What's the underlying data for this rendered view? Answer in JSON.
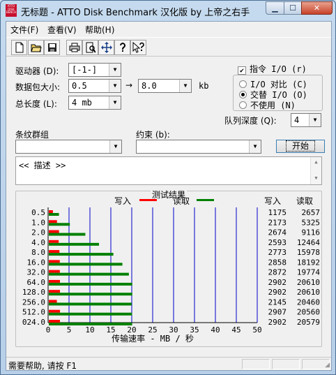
{
  "window": {
    "title": "无标题 - ATTO Disk Benchmark 汉化版 by 上帝之右手",
    "icon_text": "ATTO DISK BENCH"
  },
  "menu": [
    "文件(F)",
    "查看(V)",
    "帮助(H)"
  ],
  "toolbar": [
    "new-icon",
    "open-icon",
    "save-icon",
    "print-icon",
    "print-preview-icon",
    "move-icon",
    "help-icon",
    "context-help-icon"
  ],
  "form": {
    "drive_label": "驱动器 (D):",
    "drive_value": "[-1-]",
    "transfer_label": "数据包大小:",
    "transfer_from": "0.5",
    "transfer_to": "8.0",
    "transfer_unit": "kb",
    "total_label": "总长度 (L):",
    "total_value": "4 mb",
    "stripe_label": "条纹群组",
    "stripe_value": "",
    "constraint_label": "约束 (b):",
    "constraint_value": "",
    "start_label": "开始",
    "direct_io_label": "指令 I/O (r)",
    "direct_io_checked": true,
    "io_options": [
      "I/O 对比 (C)",
      "交替 I/O (O)",
      "不使用 (N)"
    ],
    "io_selected": 1,
    "queue_label": "队列深度 (Q):",
    "queue_value": "4"
  },
  "description": "<< 描述 >>",
  "results": {
    "title": "测试结果",
    "write_label": "写入",
    "read_label": "读取",
    "write_col_header": "写入",
    "read_col_header": "读取",
    "x_axis_label": "传输速率 - MB / 秒",
    "colors": {
      "write": "#ff0000",
      "read": "#008000",
      "grid": "#0000cc"
    }
  },
  "chart_data": {
    "type": "bar",
    "categories": [
      "0.5",
      "1.0",
      "2.0",
      "4.0",
      "8.0",
      "16.0",
      "32.0",
      "64.0",
      "128.0",
      "256.0",
      "512.0",
      "024.0"
    ],
    "series": [
      {
        "name": "写入",
        "values": [
          1175,
          2173,
          2674,
          2593,
          2773,
          2858,
          2872,
          2902,
          2902,
          2145,
          2907,
          2902
        ]
      },
      {
        "name": "读取",
        "values": [
          2657,
          5325,
          9116,
          12464,
          15978,
          18192,
          19774,
          20610,
          20610,
          20460,
          20560,
          20579
        ]
      }
    ],
    "x_ticks": [
      "0",
      "5",
      "10",
      "15",
      "20",
      "25",
      "30",
      "35",
      "40",
      "45",
      "50"
    ],
    "xlabel": "传输速率 - MB / 秒",
    "xlim": [
      0,
      50
    ],
    "grid": true
  },
  "status": {
    "text": "需要帮助, 请按 F1"
  }
}
